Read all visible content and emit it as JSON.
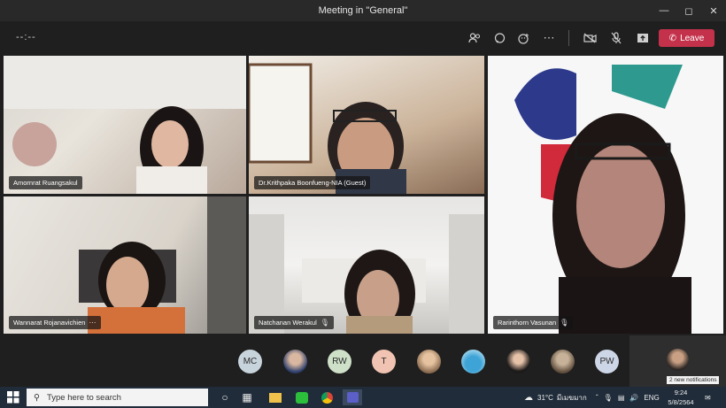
{
  "window": {
    "title": "Meeting in \"General\""
  },
  "toolbar": {
    "timer": "--:--",
    "leave_label": "Leave"
  },
  "participants": [
    {
      "name": "Amornrat Ruangsakul"
    },
    {
      "name": "Dr.Krithpaka Boonfueng-NIA (Guest)"
    },
    {
      "name": "Rarinthorn Vasunan"
    },
    {
      "name": "Wannarat Rojanavichien"
    },
    {
      "name": "Natchanan Werakul"
    }
  ],
  "roster": [
    "MC",
    "RW",
    "T",
    "PW"
  ],
  "notification": "2 new notifications",
  "taskbar": {
    "search_placeholder": "Type here to search",
    "weather": "31°C",
    "weather_desc": "มีเมฆมาก",
    "language": "ENG",
    "time": "9:24",
    "date": "5/8/2564"
  },
  "colors": {
    "leave": "#c4314b",
    "titlebar": "#292929",
    "background": "#1f1f1f",
    "taskbar": "#202c3a"
  }
}
